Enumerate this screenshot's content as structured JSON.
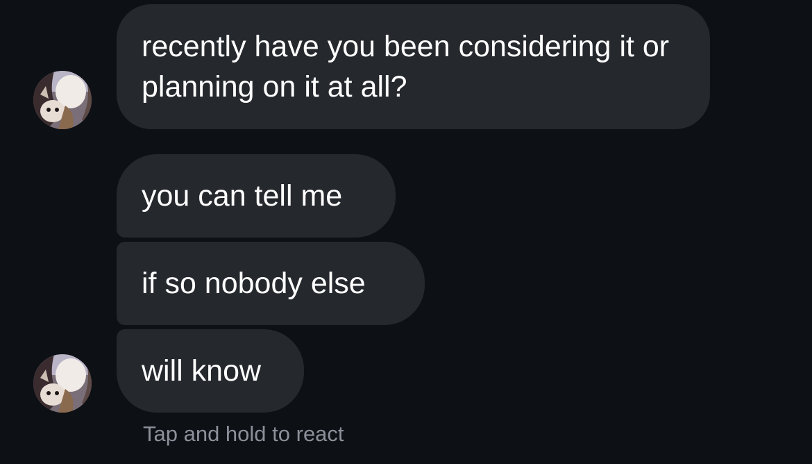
{
  "messages": [
    {
      "text": "recently have you been considering it or planning on it at all?"
    },
    {
      "text": "you can tell me"
    },
    {
      "text": "if so nobody else"
    },
    {
      "text": "will know"
    }
  ],
  "hint": "Tap and hold to react",
  "colors": {
    "background": "#0d1015",
    "bubble": "#25282d",
    "text": "#ffffff",
    "hint": "#8c9099"
  }
}
